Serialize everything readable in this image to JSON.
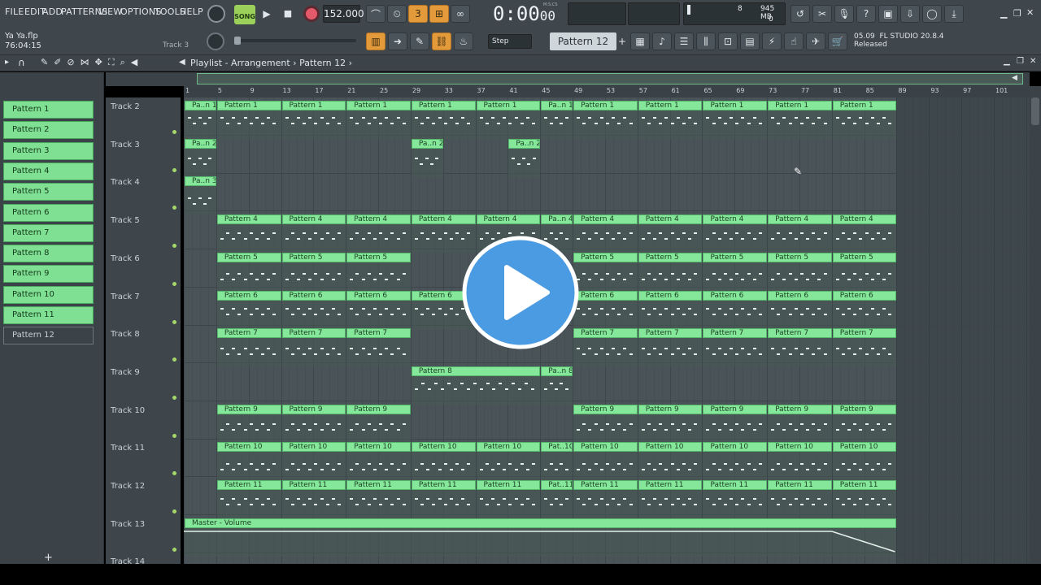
{
  "menu": [
    "FILE",
    "EDIT",
    "ADD",
    "PATTERNS",
    "VIEW",
    "OPTIONS",
    "TOOLS",
    "HELP"
  ],
  "transport": {
    "mode_label": "SONG",
    "tempo": "152.000",
    "time": "0:00",
    "time_sub": "00",
    "time_unit": "M:S:CS"
  },
  "step_label": "Step",
  "pattern_selector": "Pattern 12",
  "cpu": {
    "value": "8",
    "memory": "945 MB",
    "poly": "0"
  },
  "project": {
    "file": "Ya Ya.flp",
    "time": "76:04:15",
    "hint": "Track 3"
  },
  "news": {
    "date": "05.09",
    "title": "FL STUDIO 20.8.4",
    "status": "Released"
  },
  "breadcrumb": {
    "root": "Playlist - Arrangement",
    "current": "Pattern 12"
  },
  "bar_numbers": [
    "1",
    "5",
    "9",
    "13",
    "17",
    "21",
    "25",
    "29",
    "33",
    "37",
    "41",
    "45",
    "49",
    "53",
    "57",
    "61",
    "65",
    "69",
    "73",
    "77",
    "81",
    "85",
    "89",
    "93",
    "97",
    "101"
  ],
  "patterns": [
    "Pattern 1",
    "Pattern 2",
    "Pattern 3",
    "Pattern 4",
    "Pattern 5",
    "Pattern 6",
    "Pattern 7",
    "Pattern 8",
    "Pattern 9",
    "Pattern 10",
    "Pattern 11",
    "Pattern 12"
  ],
  "selected_pattern_index": 11,
  "tracks": [
    {
      "name": "Track 2",
      "clips": [
        {
          "label": "Pa..n 1",
          "s": 1,
          "e": 5
        },
        {
          "label": "Pattern 1",
          "s": 5,
          "e": 13
        },
        {
          "label": "Pattern 1",
          "s": 13,
          "e": 21
        },
        {
          "label": "Pattern 1",
          "s": 21,
          "e": 29
        },
        {
          "label": "Pattern 1",
          "s": 29,
          "e": 37
        },
        {
          "label": "Pattern 1",
          "s": 37,
          "e": 45
        },
        {
          "label": "Pa..n 1",
          "s": 45,
          "e": 49
        },
        {
          "label": "Pattern 1",
          "s": 49,
          "e": 57
        },
        {
          "label": "Pattern 1",
          "s": 57,
          "e": 65
        },
        {
          "label": "Pattern 1",
          "s": 65,
          "e": 73
        },
        {
          "label": "Pattern 1",
          "s": 73,
          "e": 81
        },
        {
          "label": "Pattern 1",
          "s": 81,
          "e": 89
        }
      ]
    },
    {
      "name": "Track 3",
      "clips": [
        {
          "label": "Pa..n 2",
          "s": 1,
          "e": 5
        },
        {
          "label": "Pa..n 2",
          "s": 29,
          "e": 33
        },
        {
          "label": "Pa..n 2",
          "s": 41,
          "e": 45
        }
      ]
    },
    {
      "name": "Track 4",
      "clips": [
        {
          "label": "Pa..n 3",
          "s": 1,
          "e": 5
        }
      ]
    },
    {
      "name": "Track 5",
      "clips": [
        {
          "label": "Pattern 4",
          "s": 5,
          "e": 13
        },
        {
          "label": "Pattern 4",
          "s": 13,
          "e": 21
        },
        {
          "label": "Pattern 4",
          "s": 21,
          "e": 29
        },
        {
          "label": "Pattern 4",
          "s": 29,
          "e": 37
        },
        {
          "label": "Pattern 4",
          "s": 37,
          "e": 45
        },
        {
          "label": "Pa..n 4",
          "s": 45,
          "e": 49
        },
        {
          "label": "Pattern 4",
          "s": 49,
          "e": 57
        },
        {
          "label": "Pattern 4",
          "s": 57,
          "e": 65
        },
        {
          "label": "Pattern 4",
          "s": 65,
          "e": 73
        },
        {
          "label": "Pattern 4",
          "s": 73,
          "e": 81
        },
        {
          "label": "Pattern 4",
          "s": 81,
          "e": 89
        }
      ]
    },
    {
      "name": "Track 6",
      "clips": [
        {
          "label": "Pattern 5",
          "s": 5,
          "e": 13
        },
        {
          "label": "Pattern 5",
          "s": 13,
          "e": 21
        },
        {
          "label": "Pattern 5",
          "s": 21,
          "e": 29
        },
        {
          "label": "Pattern 5",
          "s": 49,
          "e": 57
        },
        {
          "label": "Pattern 5",
          "s": 57,
          "e": 65
        },
        {
          "label": "Pattern 5",
          "s": 65,
          "e": 73
        },
        {
          "label": "Pattern 5",
          "s": 73,
          "e": 81
        },
        {
          "label": "Pattern 5",
          "s": 81,
          "e": 89
        }
      ]
    },
    {
      "name": "Track 7",
      "clips": [
        {
          "label": "Pattern 6",
          "s": 5,
          "e": 13
        },
        {
          "label": "Pattern 6",
          "s": 13,
          "e": 21
        },
        {
          "label": "Pattern 6",
          "s": 21,
          "e": 29
        },
        {
          "label": "Pattern 6",
          "s": 29,
          "e": 37
        },
        {
          "label": "Pattern 6",
          "s": 49,
          "e": 57
        },
        {
          "label": "Pattern 6",
          "s": 57,
          "e": 65
        },
        {
          "label": "Pattern 6",
          "s": 65,
          "e": 73
        },
        {
          "label": "Pattern 6",
          "s": 73,
          "e": 81
        },
        {
          "label": "Pattern 6",
          "s": 81,
          "e": 89
        }
      ]
    },
    {
      "name": "Track 8",
      "clips": [
        {
          "label": "Pattern 7",
          "s": 5,
          "e": 13
        },
        {
          "label": "Pattern 7",
          "s": 13,
          "e": 21
        },
        {
          "label": "Pattern 7",
          "s": 21,
          "e": 29
        },
        {
          "label": "Pattern 7",
          "s": 49,
          "e": 57
        },
        {
          "label": "Pattern 7",
          "s": 57,
          "e": 65
        },
        {
          "label": "Pattern 7",
          "s": 65,
          "e": 73
        },
        {
          "label": "Pattern 7",
          "s": 73,
          "e": 81
        },
        {
          "label": "Pattern 7",
          "s": 81,
          "e": 89
        }
      ]
    },
    {
      "name": "Track 9",
      "clips": [
        {
          "label": "Pattern 8",
          "s": 29,
          "e": 45
        },
        {
          "label": "Pa..n 8",
          "s": 45,
          "e": 49
        }
      ]
    },
    {
      "name": "Track 10",
      "clips": [
        {
          "label": "Pattern 9",
          "s": 5,
          "e": 13
        },
        {
          "label": "Pattern 9",
          "s": 13,
          "e": 21
        },
        {
          "label": "Pattern 9",
          "s": 21,
          "e": 29
        },
        {
          "label": "Pattern 9",
          "s": 49,
          "e": 57
        },
        {
          "label": "Pattern 9",
          "s": 57,
          "e": 65
        },
        {
          "label": "Pattern 9",
          "s": 65,
          "e": 73
        },
        {
          "label": "Pattern 9",
          "s": 73,
          "e": 81
        },
        {
          "label": "Pattern 9",
          "s": 81,
          "e": 89
        }
      ]
    },
    {
      "name": "Track 11",
      "clips": [
        {
          "label": "Pattern 10",
          "s": 5,
          "e": 13
        },
        {
          "label": "Pattern 10",
          "s": 13,
          "e": 21
        },
        {
          "label": "Pattern 10",
          "s": 21,
          "e": 29
        },
        {
          "label": "Pattern 10",
          "s": 29,
          "e": 37
        },
        {
          "label": "Pattern 10",
          "s": 37,
          "e": 45
        },
        {
          "label": "Pat..10",
          "s": 45,
          "e": 49
        },
        {
          "label": "Pattern 10",
          "s": 49,
          "e": 57
        },
        {
          "label": "Pattern 10",
          "s": 57,
          "e": 65
        },
        {
          "label": "Pattern 10",
          "s": 65,
          "e": 73
        },
        {
          "label": "Pattern 10",
          "s": 73,
          "e": 81
        },
        {
          "label": "Pattern 10",
          "s": 81,
          "e": 89
        }
      ]
    },
    {
      "name": "Track 12",
      "clips": [
        {
          "label": "Pattern 11",
          "s": 5,
          "e": 13
        },
        {
          "label": "Pattern 11",
          "s": 13,
          "e": 21
        },
        {
          "label": "Pattern 11",
          "s": 21,
          "e": 29
        },
        {
          "label": "Pattern 11",
          "s": 29,
          "e": 37
        },
        {
          "label": "Pattern 11",
          "s": 37,
          "e": 45
        },
        {
          "label": "Pat..11",
          "s": 45,
          "e": 49
        },
        {
          "label": "Pattern 11",
          "s": 49,
          "e": 57
        },
        {
          "label": "Pattern 11",
          "s": 57,
          "e": 65
        },
        {
          "label": "Pattern 11",
          "s": 65,
          "e": 73
        },
        {
          "label": "Pattern 11",
          "s": 73,
          "e": 81
        },
        {
          "label": "Pattern 11",
          "s": 81,
          "e": 89
        }
      ]
    },
    {
      "name": "Track 13",
      "clips": [
        {
          "label": "Master - Volume",
          "s": 1,
          "e": 89
        }
      ]
    },
    {
      "name": "Track 14",
      "clips": []
    }
  ],
  "colors": {
    "clip": "#84e79a",
    "clip_border": "#56b56a",
    "accent": "#e39a3b",
    "play_overlay": "#4b9be3"
  },
  "icons": [
    "play-icon",
    "stop-icon",
    "record-icon",
    "metronome-icon",
    "wait-icon",
    "countdown-icon",
    "loop-record-icon",
    "blend-notes-icon",
    "undo-icon",
    "cut-icon",
    "mic-icon",
    "help-icon",
    "save-icon",
    "export-icon",
    "chat-icon",
    "download-icon",
    "piano-icon",
    "arrow-icon",
    "paint-icon",
    "link-icon",
    "stamp-icon"
  ]
}
